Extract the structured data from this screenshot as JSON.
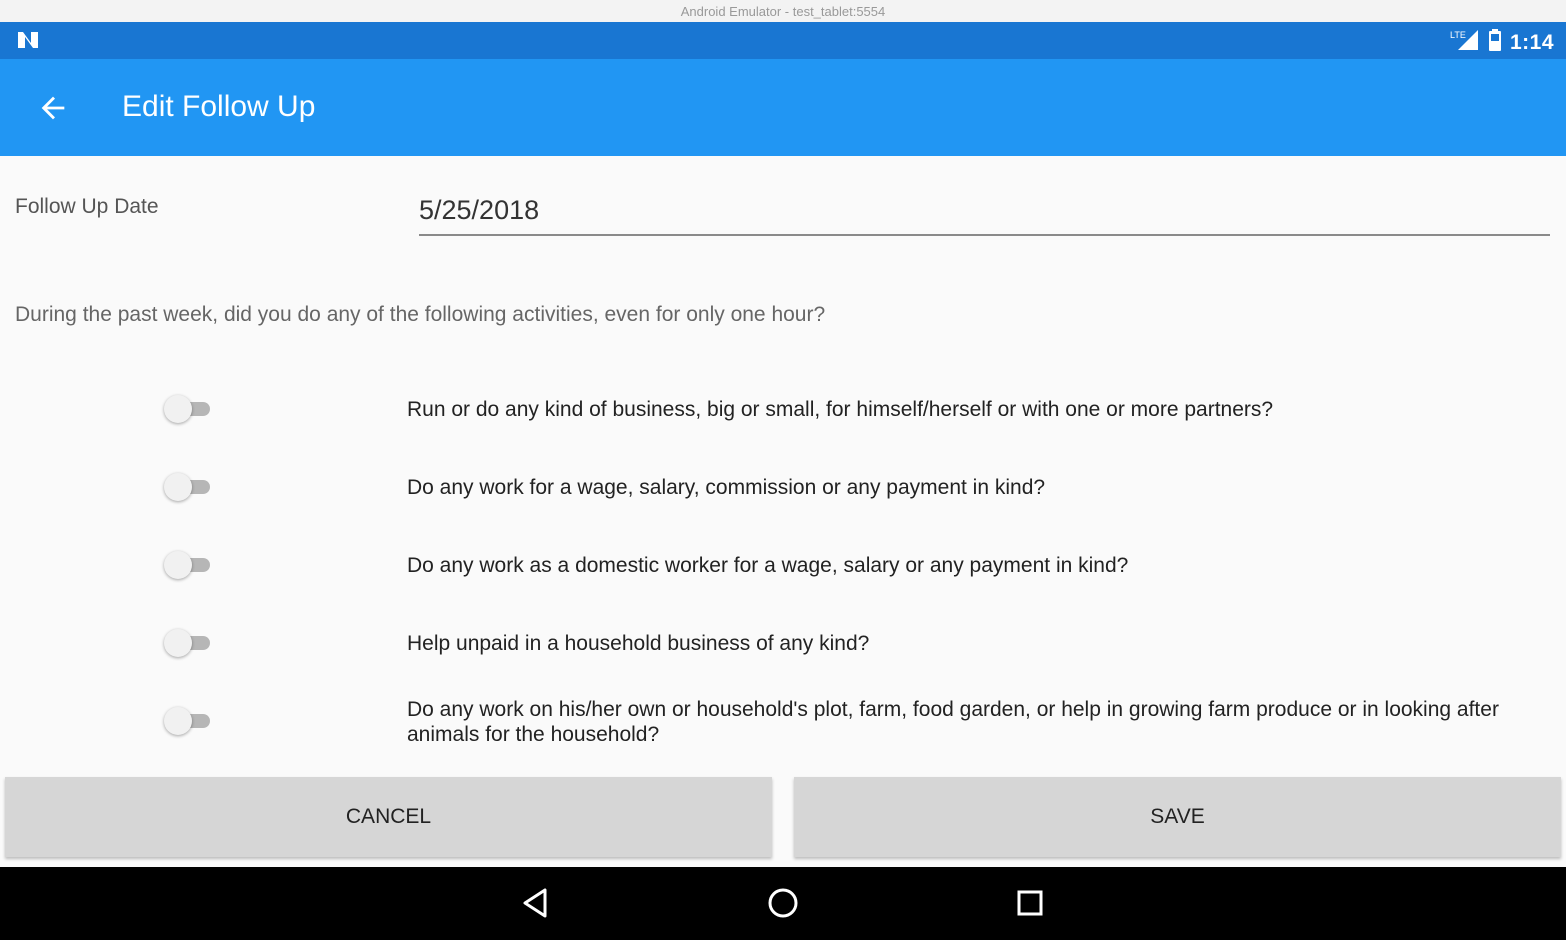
{
  "window": {
    "title": "Android Emulator - test_tablet:5554"
  },
  "status_bar": {
    "time": "1:14",
    "network": "LTE",
    "icons": [
      "n-logo-icon",
      "signal-icon",
      "battery-icon"
    ]
  },
  "app_bar": {
    "title": "Edit Follow Up",
    "back_icon": "arrow-back-icon"
  },
  "form": {
    "date_label": "Follow Up Date",
    "date_value": "5/25/2018",
    "question": "During the past week, did you do any of the following activities, even for only one hour?",
    "items": [
      {
        "label": "Run or do any kind of business, big or small, for himself/herself or with one or more partners?",
        "checked": false
      },
      {
        "label": "Do any work for a wage, salary, commission or any payment in kind?",
        "checked": false
      },
      {
        "label": "Do any work as a domestic worker for a wage, salary or any payment in kind?",
        "checked": false
      },
      {
        "label": "Help unpaid in a household business of any kind?",
        "checked": false
      },
      {
        "label": "Do any work on his/her own or household's plot, farm, food garden, or help in growing farm produce or in looking after animals for the household?",
        "checked": false
      }
    ]
  },
  "actions": {
    "cancel_label": "CANCEL",
    "save_label": "SAVE"
  },
  "nav_bar": {
    "icons": [
      "back-triangle-icon",
      "home-circle-icon",
      "recents-square-icon"
    ]
  },
  "colors": {
    "status_bar": "#1976d2",
    "app_bar": "#2196f3",
    "button": "#d6d6d6",
    "background": "#fafafa"
  }
}
